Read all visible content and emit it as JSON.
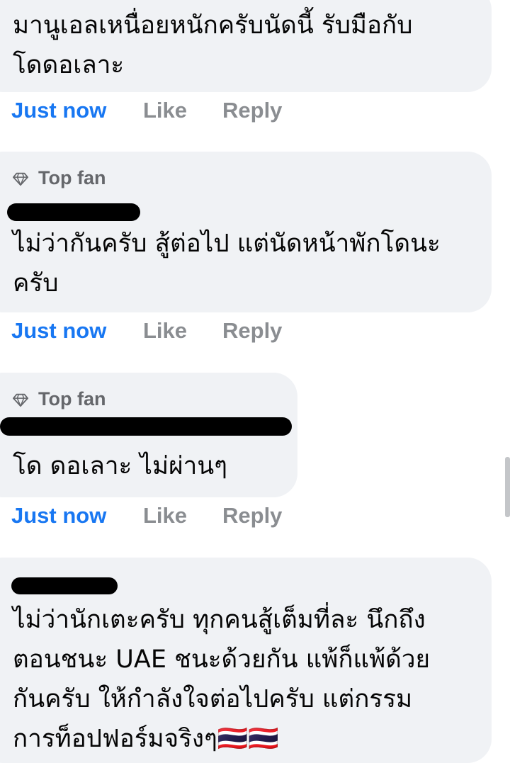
{
  "comments": [
    {
      "text": "มานูเอลเหนื่อยหนักครับนัดนี้ รับมือกับ\nโดดอเลาะ",
      "time": "Just now",
      "like": "Like",
      "reply": "Reply"
    },
    {
      "badge": "Top fan",
      "text": "ไม่ว่ากันครับ สู้ต่อไป แต่นัดหน้าพักโดนะ\nครับ",
      "time": "Just now",
      "like": "Like",
      "reply": "Reply"
    },
    {
      "badge": "Top fan",
      "text": "โด ดอเลาะ ไม่ผ่านๆ",
      "time": "Just now",
      "like": "Like",
      "reply": "Reply"
    },
    {
      "text": "ไม่ว่านักเตะครับ ทุกคนสู้เต็มที่ละ นึกถึง\nตอนชนะ UAE ชนะด้วยกัน แพ้ก็แพ้ด้วย\nกันครับ ให้กำลังใจต่อไปครับ แต่กรรม\nการท็อปฟอร์มจริงๆ🇹🇭🇹🇭"
    }
  ],
  "icons": {
    "badge": "diamond-icon",
    "flag": "thailand-flag"
  },
  "colors": {
    "bubble": "#f0f2f5",
    "time": "#1877f2",
    "action": "#8a8d91",
    "badge": "#65676b"
  }
}
